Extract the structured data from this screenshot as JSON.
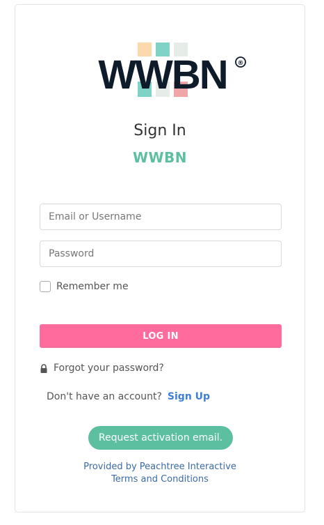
{
  "logo": {
    "text": "WWBN",
    "registered_mark": "®",
    "block_colors": [
      "#fbd9ad",
      "#7fd3c6",
      "#e6ede9",
      "#f0a6a8"
    ]
  },
  "heading": {
    "title": "Sign In",
    "site_name": "WWBN"
  },
  "form": {
    "email_placeholder": "Email or Username",
    "password_placeholder": "Password",
    "remember_label": "Remember me",
    "login_label": "LOG IN",
    "forgot_label": "Forgot your password?"
  },
  "signup": {
    "prompt": "Don't have an account?",
    "link_label": "Sign Up"
  },
  "activation": {
    "button_label": "Request activation email."
  },
  "footer": {
    "provider": "Provided by Peachtree Interactive",
    "terms": "Terms and Conditions"
  },
  "colors": {
    "accent_pink": "#ff6b9c",
    "accent_teal": "#5cc0a0",
    "link_blue": "#3e7fd6"
  }
}
